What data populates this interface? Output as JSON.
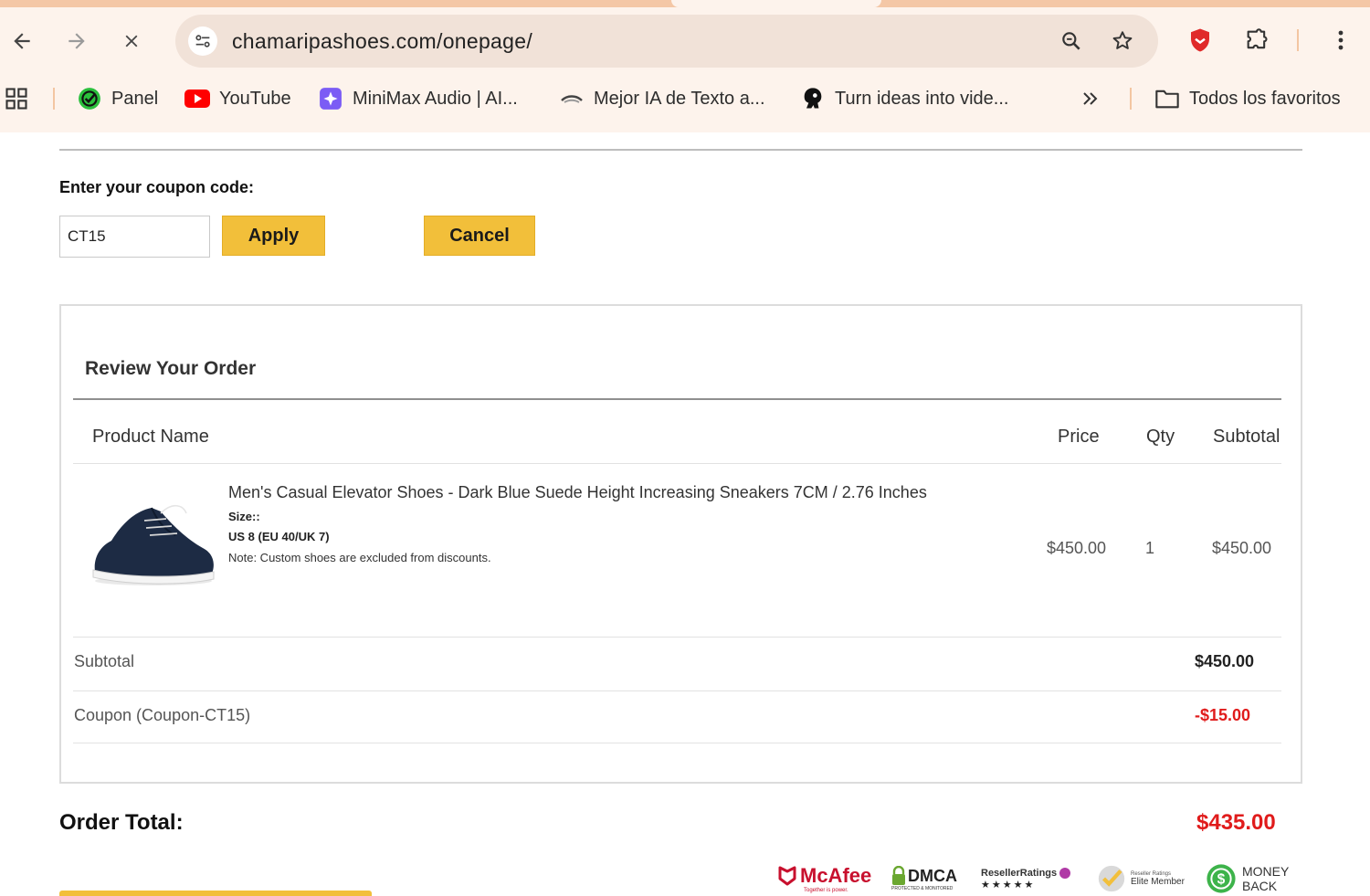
{
  "browser": {
    "url": "chamaripashoes.com/onepage/",
    "bookmarks": [
      {
        "label": "Panel",
        "icon": "panel-icon"
      },
      {
        "label": "YouTube",
        "icon": "youtube-icon"
      },
      {
        "label": "MiniMax Audio | AI...",
        "icon": "minimax-icon"
      },
      {
        "label": "Mejor IA de Texto a...",
        "icon": "texto-ia-icon"
      },
      {
        "label": "Turn ideas into vide...",
        "icon": "ideas-video-icon"
      }
    ],
    "all_bookmarks_label": "Todos los favoritos"
  },
  "coupon": {
    "label": "Enter your coupon code:",
    "value": "CT15",
    "apply_label": "Apply",
    "cancel_label": "Cancel"
  },
  "review": {
    "title": "Review Your Order",
    "columns": {
      "product": "Product Name",
      "price": "Price",
      "qty": "Qty",
      "subtotal": "Subtotal"
    },
    "item": {
      "name": "Men's Casual Elevator Shoes - Dark Blue Suede Height Increasing Sneakers 7CM / 2.76 Inches",
      "size_label": "Size::",
      "size_value": "US 8 (EU 40/UK 7)",
      "note": "Note: Custom shoes are excluded from discounts.",
      "price": "$450.00",
      "qty": "1",
      "subtotal": "$450.00"
    },
    "subtotal_label": "Subtotal",
    "subtotal_value": "$450.00",
    "coupon_label": "Coupon (Coupon-CT15)",
    "coupon_value": "-$15.00"
  },
  "order_total": {
    "label": "Order Total:",
    "value": "$435.00"
  },
  "trust_badges": {
    "mcafee": "McAfee",
    "mcafee_tag": "Together is power.",
    "dmca": "DMCA",
    "dmca_tag": "PROTECTED & MONITORED",
    "reseller": "ResellerRatings",
    "elite_top": "Reseller Ratings",
    "elite": "Elite Member",
    "money_back_1": "MONEY",
    "money_back_2": "BACK"
  },
  "colors": {
    "accent_yellow": "#f2bf3a",
    "price_red": "#e01b1b"
  }
}
